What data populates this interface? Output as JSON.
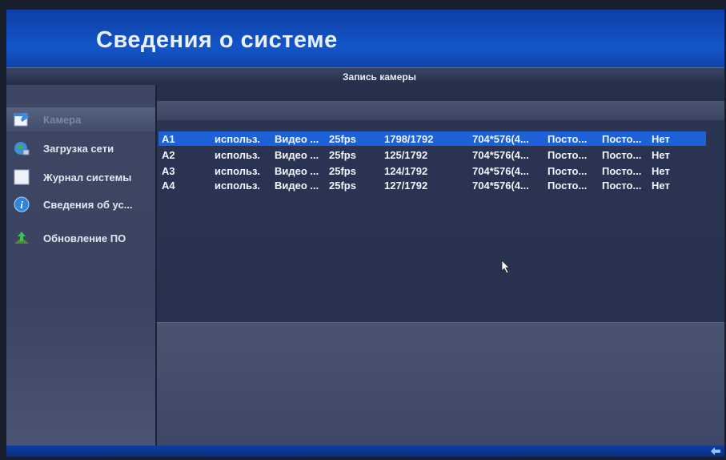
{
  "header": {
    "title": "Сведения о системе"
  },
  "tab": {
    "label": "Запись камеры"
  },
  "sidebar": {
    "items": [
      {
        "label": "Камера",
        "icon": "notepad-icon",
        "selected": true
      },
      {
        "label": "Загрузка сети",
        "icon": "network-globe-icon",
        "selected": false
      },
      {
        "label": "Журнал системы",
        "icon": "log-page-icon",
        "selected": false
      },
      {
        "label": "Сведения об ус...",
        "icon": "info-icon",
        "selected": false
      },
      {
        "label": "Обновление ПО",
        "icon": "upgrade-icon",
        "selected": false
      }
    ]
  },
  "table": {
    "rows": [
      {
        "channel": "A1",
        "status": "использ.",
        "type": "Видео ...",
        "fps": "25fps",
        "bitrate": "1798/1792",
        "resolution": "704*576(4...",
        "stream1": "Посто...",
        "stream2": "Посто...",
        "audio": "Нет",
        "selected": true
      },
      {
        "channel": "A2",
        "status": "использ.",
        "type": "Видео ...",
        "fps": "25fps",
        "bitrate": "125/1792",
        "resolution": "704*576(4...",
        "stream1": "Посто...",
        "stream2": "Посто...",
        "audio": "Нет",
        "selected": false
      },
      {
        "channel": "A3",
        "status": "использ.",
        "type": "Видео ...",
        "fps": "25fps",
        "bitrate": "124/1792",
        "resolution": "704*576(4...",
        "stream1": "Посто...",
        "stream2": "Посто...",
        "audio": "Нет",
        "selected": false
      },
      {
        "channel": "A4",
        "status": "использ.",
        "type": "Видео ...",
        "fps": "25fps",
        "bitrate": "127/1792",
        "resolution": "704*576(4...",
        "stream1": "Посто...",
        "stream2": "Посто...",
        "audio": "Нет",
        "selected": false
      }
    ]
  },
  "colors": {
    "accent": "#1d61d8",
    "header": "#1355c8",
    "panel": "#26304a"
  }
}
